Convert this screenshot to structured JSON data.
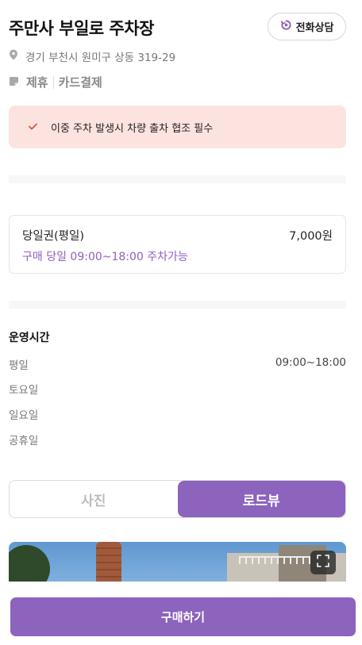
{
  "header": {
    "title": "주만사 부일로 주차장",
    "call_label": "전화상담"
  },
  "info": {
    "address": "경기 부천시 원미구 상동 319-29",
    "tags": [
      "제휴",
      "카드결제"
    ]
  },
  "notice": {
    "text": "이중 주차 발생시 차량 출차 협조 필수"
  },
  "ticket": {
    "name": "당일권(평일)",
    "price": "7,000원",
    "description": "구매 당일 09:00~18:00 주차가능"
  },
  "hours": {
    "title": "운영시간",
    "rows": [
      {
        "day": "평일",
        "time": "09:00~18:00"
      },
      {
        "day": "토요일",
        "time": ""
      },
      {
        "day": "일요일",
        "time": ""
      },
      {
        "day": "공휴일",
        "time": ""
      }
    ]
  },
  "media_tabs": {
    "photo": "사진",
    "roadview": "로드뷰",
    "active": "roadview"
  },
  "footer": {
    "buy_label": "구매하기"
  },
  "colors": {
    "accent": "#8c63bd",
    "notice_bg": "#fde3e0",
    "check": "#e0533d"
  },
  "icons": {
    "call": "refresh-phone-icon",
    "address": "map-pin-icon",
    "tags": "tag-icon",
    "notice": "check-icon",
    "expand": "expand-icon"
  }
}
